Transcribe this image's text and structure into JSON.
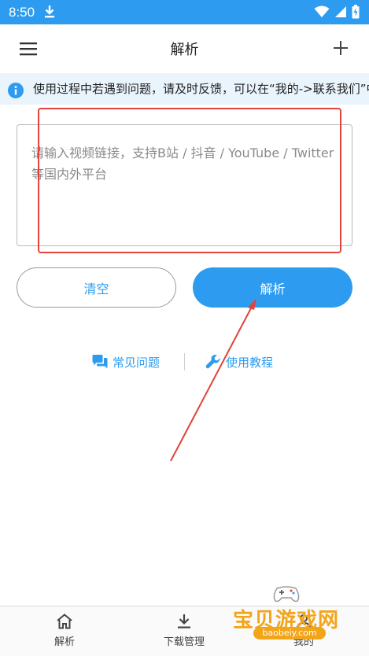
{
  "status_bar": {
    "time": "8:50"
  },
  "app_bar": {
    "title": "解析"
  },
  "notice": {
    "text": "使用过程中若遇到问题，请及时反馈，可以在“我的->联系我们”中反馈"
  },
  "input": {
    "placeholder": "请输入视频链接，支持B站 / 抖音 / YouTube / Twitter等国内外平台",
    "value": ""
  },
  "buttons": {
    "clear": "清空",
    "parse": "解析"
  },
  "help": {
    "faq": "常见问题",
    "tutorial": "使用教程"
  },
  "bottom_nav": {
    "items": [
      {
        "label": "解析",
        "icon": "home-icon"
      },
      {
        "label": "下载管理",
        "icon": "download-icon"
      },
      {
        "label": "我的",
        "icon": "person-icon"
      }
    ]
  },
  "watermark": {
    "title": "宝贝游戏网",
    "url": "baobeiy.com"
  },
  "colors": {
    "accent": "#2d9cf0",
    "annotation": "#e0443a",
    "watermark": "#f3a51a"
  }
}
